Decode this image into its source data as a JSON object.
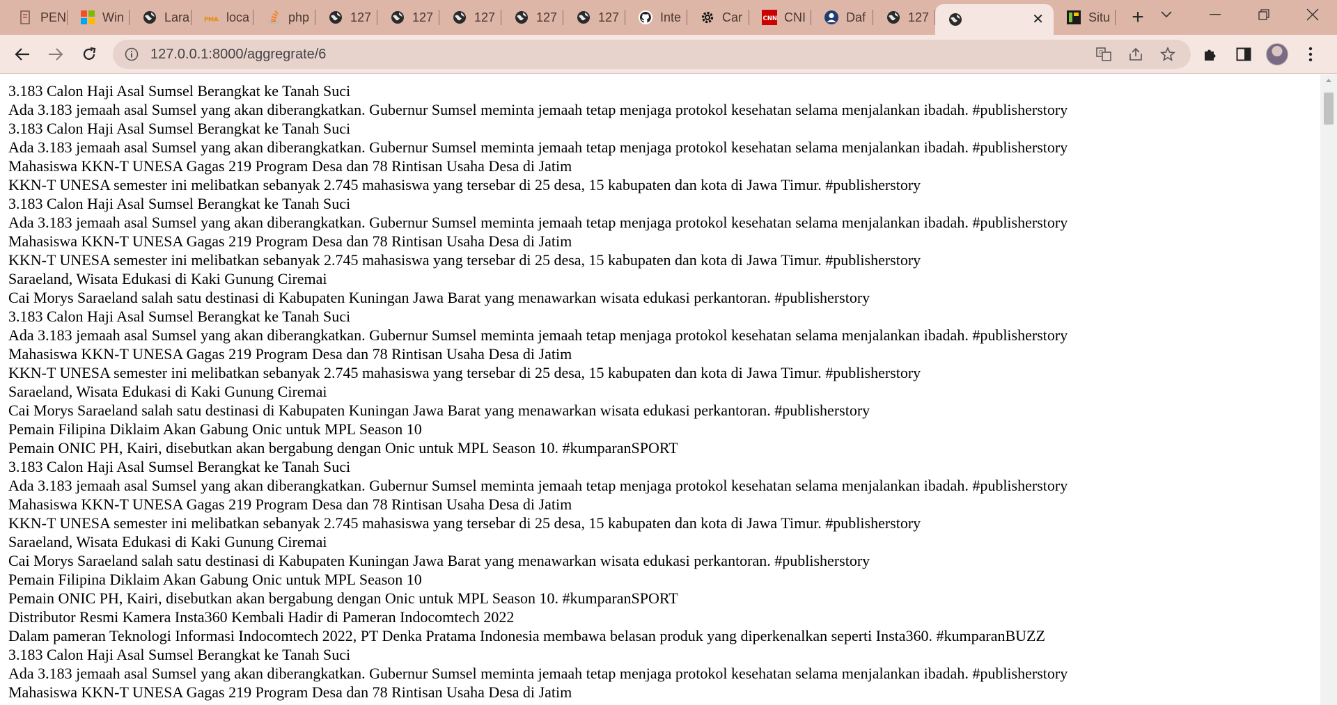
{
  "browser": {
    "tabs": [
      {
        "title": "PEN",
        "icon": "book-icon"
      },
      {
        "title": "Win",
        "icon": "windows-icon"
      },
      {
        "title": "Lara",
        "icon": "globe-icon"
      },
      {
        "title": "loca",
        "icon": "phpmyadmin-icon"
      },
      {
        "title": "php",
        "icon": "stackoverflow-icon"
      },
      {
        "title": "127",
        "icon": "globe-icon"
      },
      {
        "title": "127",
        "icon": "globe-icon"
      },
      {
        "title": "127",
        "icon": "globe-icon"
      },
      {
        "title": "127",
        "icon": "globe-icon"
      },
      {
        "title": "127",
        "icon": "globe-icon"
      },
      {
        "title": "Inte",
        "icon": "github-icon"
      },
      {
        "title": "Car",
        "icon": "gear-icon"
      },
      {
        "title": "CNI",
        "icon": "cnn-icon"
      },
      {
        "title": "Daf",
        "icon": "person-icon"
      },
      {
        "title": "127",
        "icon": "globe-icon"
      }
    ],
    "active_tab": {
      "title": "",
      "icon": "globe-icon"
    },
    "last_tab": {
      "title": "Situ",
      "icon": "site-icon"
    },
    "url": "127.0.0.1:8000/aggregrate/6",
    "accent_color": "#ddb6a8",
    "toolbar_color": "#f6e6e2"
  },
  "page": {
    "lines": [
      "3.183 Calon Haji Asal Sumsel Berangkat ke Tanah Suci",
      "Ada 3.183 jemaah asal Sumsel yang akan diberangkatkan. Gubernur Sumsel meminta jemaah tetap menjaga protokol kesehatan selama menjalankan ibadah. #publisherstory",
      "3.183 Calon Haji Asal Sumsel Berangkat ke Tanah Suci",
      "Ada 3.183 jemaah asal Sumsel yang akan diberangkatkan. Gubernur Sumsel meminta jemaah tetap menjaga protokol kesehatan selama menjalankan ibadah. #publisherstory",
      "Mahasiswa KKN-T UNESA Gagas 219 Program Desa dan 78 Rintisan Usaha Desa di Jatim",
      "KKN-T UNESA semester ini melibatkan sebanyak 2.745 mahasiswa yang tersebar di 25 desa, 15 kabupaten dan kota di Jawa Timur. #publisherstory",
      "3.183 Calon Haji Asal Sumsel Berangkat ke Tanah Suci",
      "Ada 3.183 jemaah asal Sumsel yang akan diberangkatkan. Gubernur Sumsel meminta jemaah tetap menjaga protokol kesehatan selama menjalankan ibadah. #publisherstory",
      "Mahasiswa KKN-T UNESA Gagas 219 Program Desa dan 78 Rintisan Usaha Desa di Jatim",
      "KKN-T UNESA semester ini melibatkan sebanyak 2.745 mahasiswa yang tersebar di 25 desa, 15 kabupaten dan kota di Jawa Timur. #publisherstory",
      "Saraeland, Wisata Edukasi di Kaki Gunung Ciremai",
      "Cai Morys Saraeland salah satu destinasi di Kabupaten Kuningan Jawa Barat yang menawarkan wisata edukasi perkantoran. #publisherstory",
      "3.183 Calon Haji Asal Sumsel Berangkat ke Tanah Suci",
      "Ada 3.183 jemaah asal Sumsel yang akan diberangkatkan. Gubernur Sumsel meminta jemaah tetap menjaga protokol kesehatan selama menjalankan ibadah. #publisherstory",
      "Mahasiswa KKN-T UNESA Gagas 219 Program Desa dan 78 Rintisan Usaha Desa di Jatim",
      "KKN-T UNESA semester ini melibatkan sebanyak 2.745 mahasiswa yang tersebar di 25 desa, 15 kabupaten dan kota di Jawa Timur. #publisherstory",
      "Saraeland, Wisata Edukasi di Kaki Gunung Ciremai",
      "Cai Morys Saraeland salah satu destinasi di Kabupaten Kuningan Jawa Barat yang menawarkan wisata edukasi perkantoran. #publisherstory",
      "Pemain Filipina Diklaim Akan Gabung Onic untuk MPL Season 10",
      "Pemain ONIC PH, Kairi, disebutkan akan bergabung dengan Onic untuk MPL Season 10. #kumparanSPORT",
      "3.183 Calon Haji Asal Sumsel Berangkat ke Tanah Suci",
      "Ada 3.183 jemaah asal Sumsel yang akan diberangkatkan. Gubernur Sumsel meminta jemaah tetap menjaga protokol kesehatan selama menjalankan ibadah. #publisherstory",
      "Mahasiswa KKN-T UNESA Gagas 219 Program Desa dan 78 Rintisan Usaha Desa di Jatim",
      "KKN-T UNESA semester ini melibatkan sebanyak 2.745 mahasiswa yang tersebar di 25 desa, 15 kabupaten dan kota di Jawa Timur. #publisherstory",
      "Saraeland, Wisata Edukasi di Kaki Gunung Ciremai",
      "Cai Morys Saraeland salah satu destinasi di Kabupaten Kuningan Jawa Barat yang menawarkan wisata edukasi perkantoran. #publisherstory",
      "Pemain Filipina Diklaim Akan Gabung Onic untuk MPL Season 10",
      "Pemain ONIC PH, Kairi, disebutkan akan bergabung dengan Onic untuk MPL Season 10. #kumparanSPORT",
      "Distributor Resmi Kamera Insta360 Kembali Hadir di Pameran Indocomtech 2022",
      "Dalam pameran Teknologi Informasi Indocomtech 2022, PT Denka Pratama Indonesia membawa belasan produk yang diperkenalkan seperti Insta360. #kumparanBUZZ",
      "3.183 Calon Haji Asal Sumsel Berangkat ke Tanah Suci",
      "Ada 3.183 jemaah asal Sumsel yang akan diberangkatkan. Gubernur Sumsel meminta jemaah tetap menjaga protokol kesehatan selama menjalankan ibadah. #publisherstory",
      "Mahasiswa KKN-T UNESA Gagas 219 Program Desa dan 78 Rintisan Usaha Desa di Jatim"
    ]
  }
}
